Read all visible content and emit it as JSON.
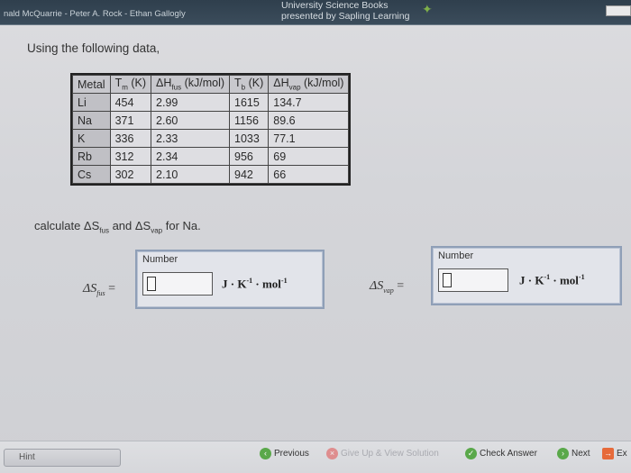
{
  "header": {
    "authors": "nald McQuarrie - Peter A. Rock - Ethan Gallogly",
    "publisher_line1": "University Science Books",
    "publisher_line2": "presented by Sapling Learning"
  },
  "question": {
    "intro": "Using the following data,",
    "calc_prefix": "calculate ΔS",
    "calc_sub1": "fus",
    "calc_mid": " and ΔS",
    "calc_sub2": "vap",
    "calc_suffix": " for Na."
  },
  "table": {
    "headers": {
      "metal": "Metal",
      "tm_pre": "T",
      "tm_sub": "m",
      "tm_post": " (K)",
      "hfus_pre": "ΔH",
      "hfus_sub": "fus",
      "hfus_post": " (kJ/mol)",
      "tb_pre": "T",
      "tb_sub": "b",
      "tb_post": " (K)",
      "hvap_pre": "ΔH",
      "hvap_sub": "vap",
      "hvap_post": " (kJ/mol)"
    },
    "rows": [
      {
        "metal": "Li",
        "tm": "454",
        "hfus": "2.99",
        "tb": "1615",
        "hvap": "134.7"
      },
      {
        "metal": "Na",
        "tm": "371",
        "hfus": "2.60",
        "tb": "1156",
        "hvap": "89.6"
      },
      {
        "metal": "K",
        "tm": "336",
        "hfus": "2.33",
        "tb": "1033",
        "hvap": "77.1"
      },
      {
        "metal": "Rb",
        "tm": "312",
        "hfus": "2.34",
        "tb": "956",
        "hvap": "69"
      },
      {
        "metal": "Cs",
        "tm": "302",
        "hfus": "2.10",
        "tb": "942",
        "hvap": "66"
      }
    ]
  },
  "answers": {
    "fus": {
      "delta": "ΔS",
      "sub": "fus",
      "equals": "=",
      "number_label": "Number",
      "value": "",
      "unit_j": "J · K",
      "unit_k_exp": "-1",
      "unit_mol": " · mol",
      "unit_mol_exp": "-1"
    },
    "vap": {
      "delta": "ΔS",
      "sub": "vap",
      "equals": "=",
      "number_label": "Number",
      "value": "",
      "unit_j": "J · K",
      "unit_k_exp": "-1",
      "unit_mol": " · mol",
      "unit_mol_exp": "-1"
    }
  },
  "footer": {
    "hint": "Hint",
    "previous": "Previous",
    "give_up": "Give Up & View Solution",
    "check": "Check Answer",
    "next": "Next",
    "exit": "Ex"
  }
}
